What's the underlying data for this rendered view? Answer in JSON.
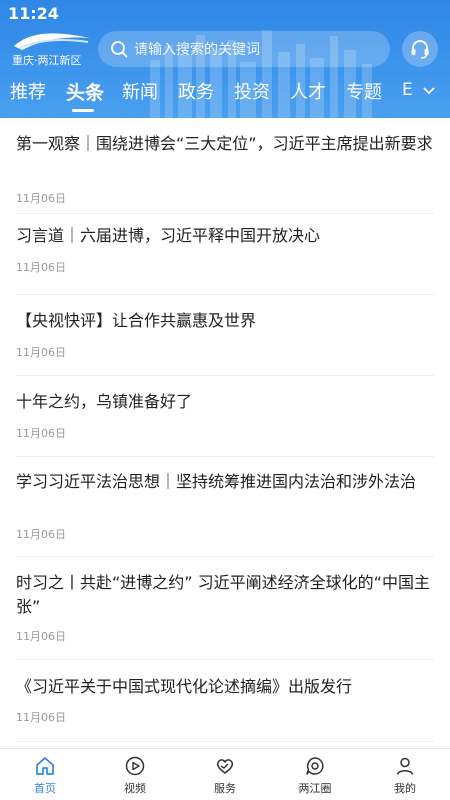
{
  "status_bar": {
    "time": "11:24"
  },
  "header": {
    "logo_text": "重庆·两江新区",
    "search_placeholder": "请输入搜索的关键词",
    "service_icon": "headset-icon"
  },
  "tabs": [
    {
      "label": "推荐",
      "active": false
    },
    {
      "label": "头条",
      "active": true
    },
    {
      "label": "新闻",
      "active": false
    },
    {
      "label": "政务",
      "active": false
    },
    {
      "label": "投资",
      "active": false
    },
    {
      "label": "人才",
      "active": false
    },
    {
      "label": "专题",
      "active": false
    },
    {
      "label": "E",
      "active": false
    }
  ],
  "articles": [
    {
      "title": "第一观察｜围绕进博会“三大定位”，习近平主席提出新要求",
      "date": "11月06日"
    },
    {
      "title": "习言道｜六届进博，习近平释中国开放决心",
      "date": "11月06日"
    },
    {
      "title": "【央视快评】让合作共赢惠及世界",
      "date": "11月06日"
    },
    {
      "title": "十年之约，乌镇准备好了",
      "date": "11月06日"
    },
    {
      "title": "学习习近平法治思想｜坚持统筹推进国内法治和涉外法治",
      "date": "11月06日"
    },
    {
      "title": "时习之丨共赴“进博之约” 习近平阐述经济全球化的“中国主张”",
      "date": "11月06日"
    },
    {
      "title": "《习近平关于中国式现代化论述摘编》出版发行",
      "date": "11月06日"
    }
  ],
  "bottom_nav": [
    {
      "label": "首页",
      "icon": "home-icon",
      "active": true
    },
    {
      "label": "视频",
      "icon": "play-icon",
      "active": false
    },
    {
      "label": "服务",
      "icon": "heart-hand-icon",
      "active": false
    },
    {
      "label": "两江圈",
      "icon": "chat-bubble-icon",
      "active": false
    },
    {
      "label": "我的",
      "icon": "user-icon",
      "active": false
    }
  ],
  "colors": {
    "brand": "#2f86e6",
    "text": "#222222",
    "muted": "#999999"
  }
}
